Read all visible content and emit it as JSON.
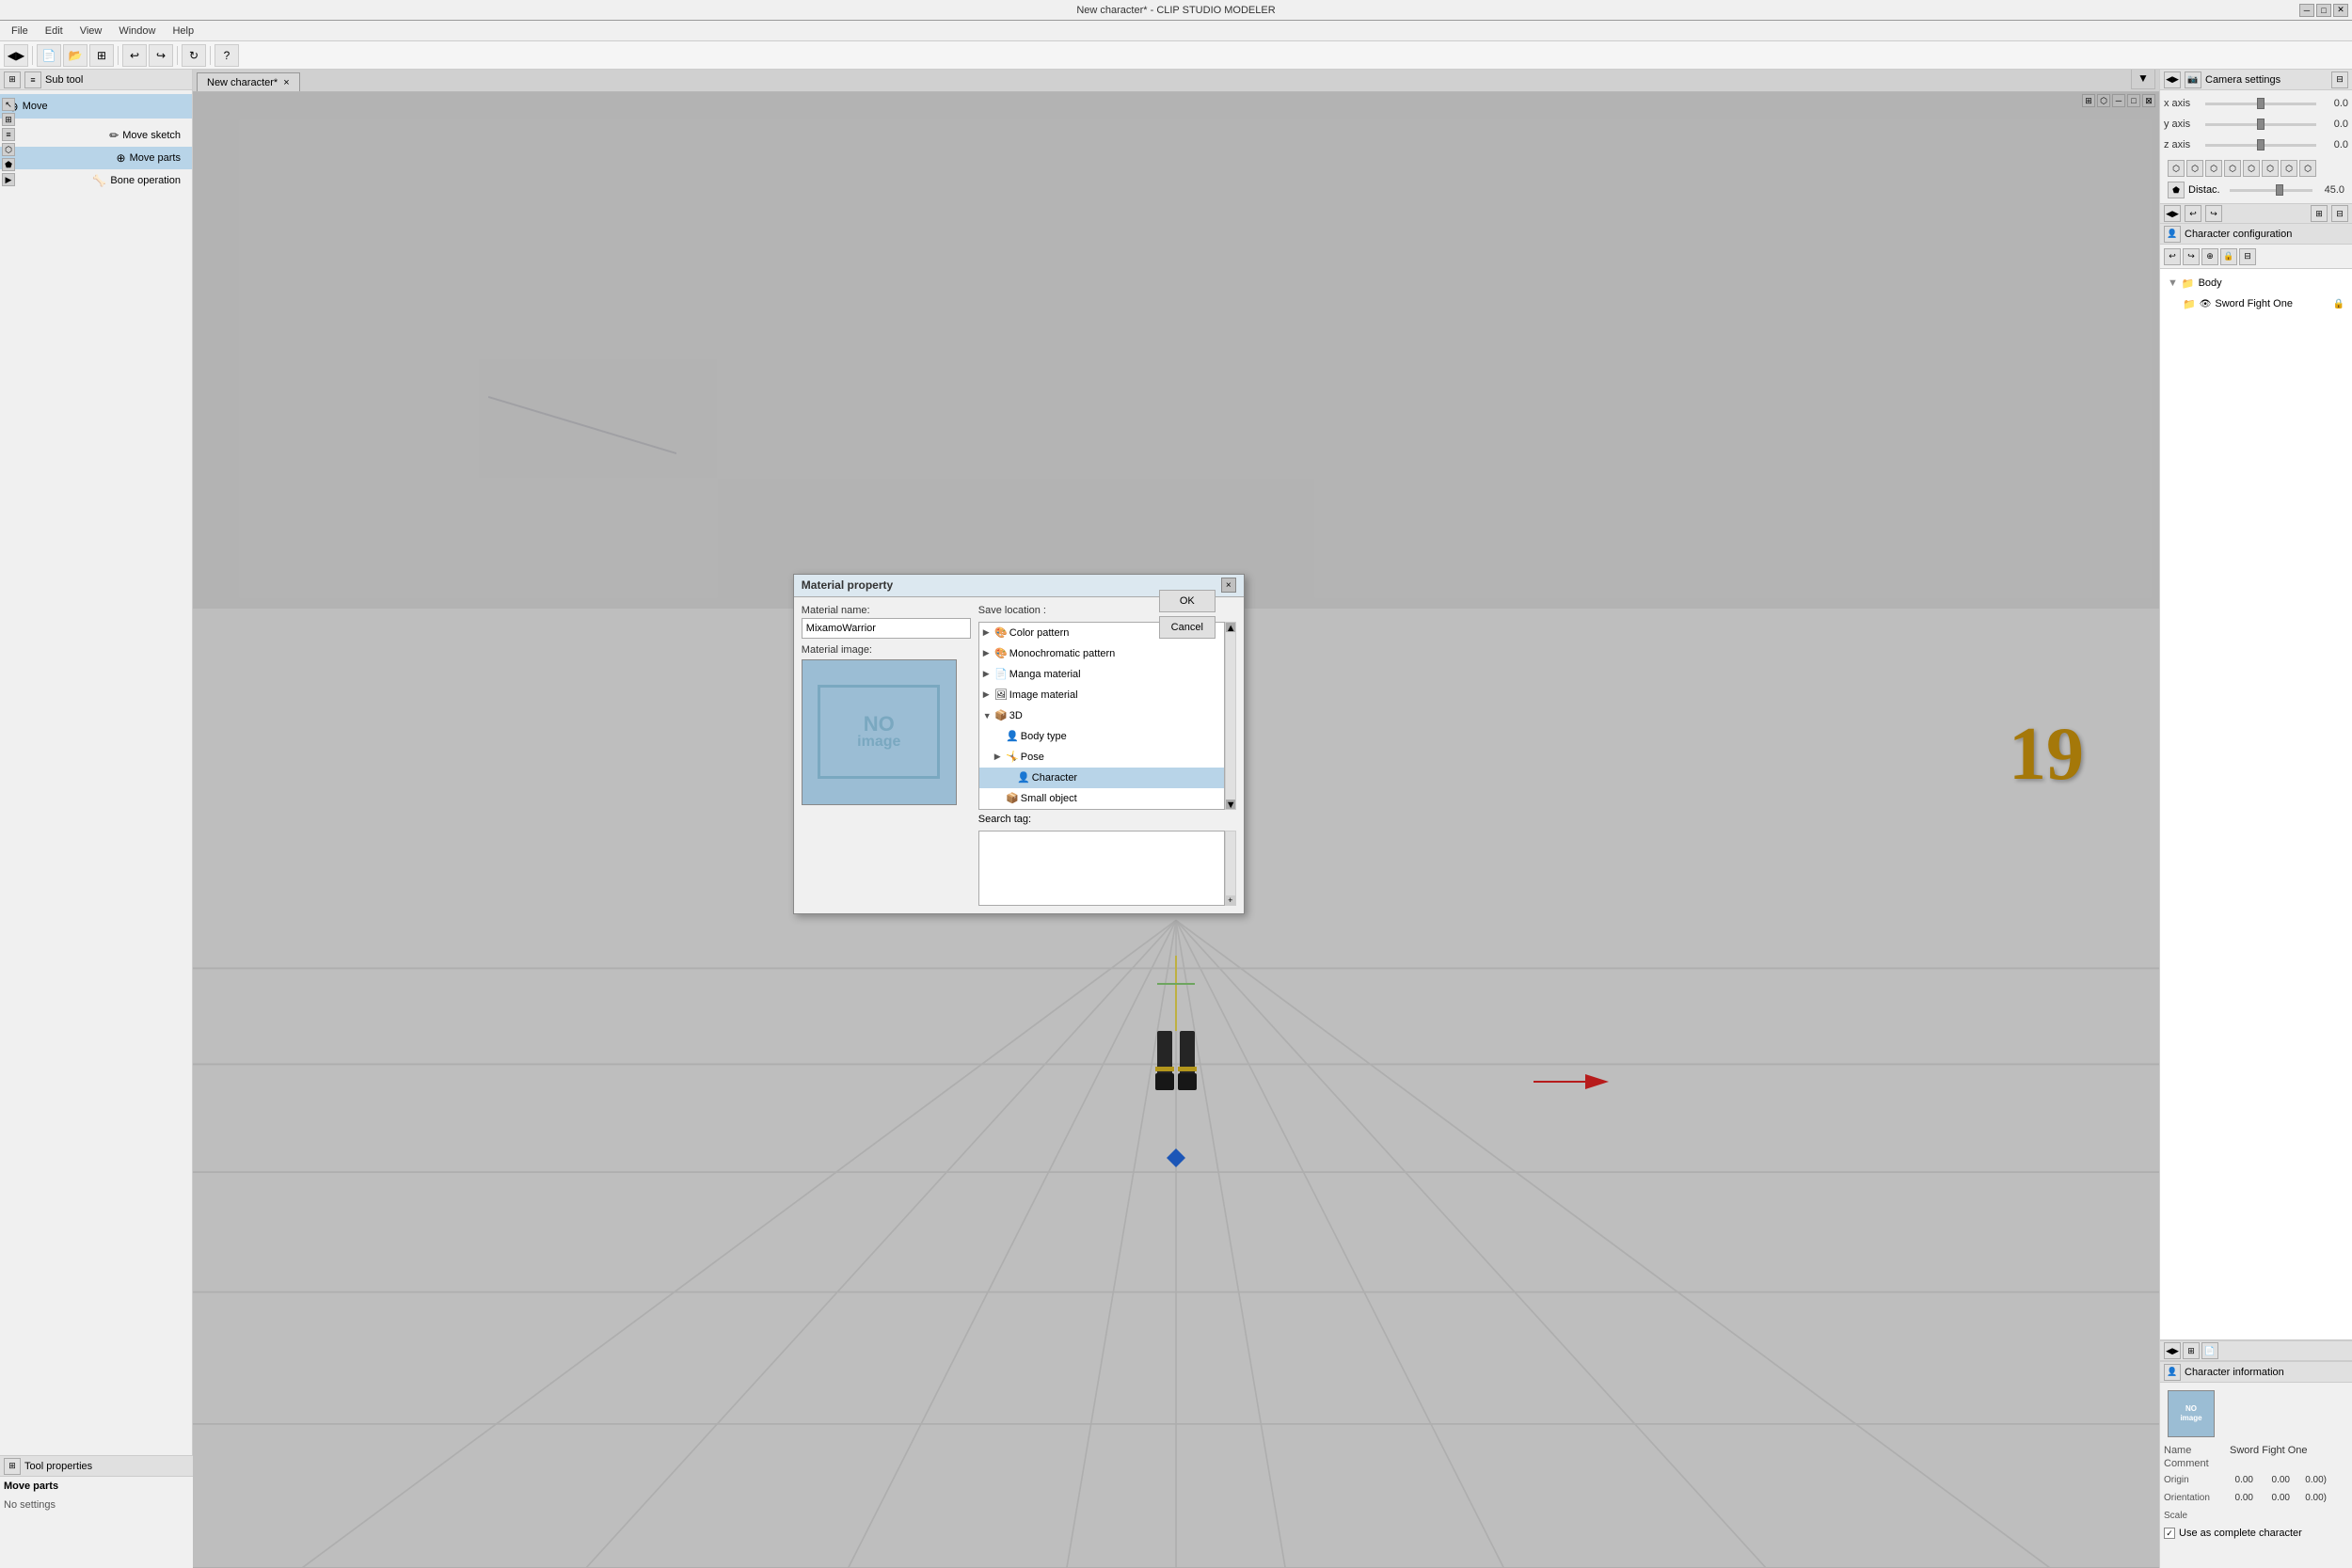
{
  "app": {
    "title": "New character* - CLIP STUDIO MODELER",
    "title_controls": [
      "minimize",
      "maximize",
      "close"
    ]
  },
  "menu": {
    "items": [
      "File",
      "Edit",
      "View",
      "Window",
      "Help"
    ]
  },
  "toolbar": {
    "buttons": [
      "save",
      "new",
      "open",
      "duplicate",
      "board",
      "undo",
      "redo",
      "refresh",
      "help"
    ]
  },
  "tab": {
    "label": "New character*",
    "close": "×"
  },
  "left_panel": {
    "header": "Sub tool",
    "tools": [
      {
        "id": "move",
        "label": "Move",
        "active": true,
        "icon": "⊕"
      },
      {
        "id": "move-sketch",
        "label": "Move sketch",
        "indent": true
      },
      {
        "id": "move-parts",
        "label": "Move parts",
        "indent": true,
        "active": true
      },
      {
        "id": "bone-op",
        "label": "Bone operation",
        "indent": true
      }
    ]
  },
  "tool_properties": {
    "header": "Tool properties",
    "sub_label": "Move parts",
    "content": "No settings"
  },
  "canvas": {
    "badge_number": "19"
  },
  "modal": {
    "title": "Material property",
    "close_btn": "×",
    "material_name_label": "Material name:",
    "material_name_value": "MixamoWarrior",
    "material_image_label": "Material image:",
    "no_image_line1": "NO",
    "no_image_line2": "image",
    "save_location_label": "Save location :",
    "location_tree": [
      {
        "id": "color-pattern",
        "label": "Color pattern",
        "level": 0,
        "arrow": "▶",
        "icon": "🎨"
      },
      {
        "id": "monochromatic",
        "label": "Monochromatic pattern",
        "level": 0,
        "arrow": "▶",
        "icon": "🎨"
      },
      {
        "id": "manga",
        "label": "Manga material",
        "level": 0,
        "arrow": "▶",
        "icon": "📄"
      },
      {
        "id": "image-material",
        "label": "Image material",
        "level": 0,
        "arrow": "▶",
        "icon": "🖼"
      },
      {
        "id": "3d",
        "label": "3D",
        "level": 0,
        "arrow": "▼",
        "icon": "📦"
      },
      {
        "id": "body-type",
        "label": "Body type",
        "level": 1,
        "arrow": "",
        "icon": "👤"
      },
      {
        "id": "pose",
        "label": "Pose",
        "level": 1,
        "arrow": "▶",
        "icon": "🤸"
      },
      {
        "id": "character",
        "label": "Character",
        "level": 2,
        "arrow": "",
        "icon": "👤",
        "selected": true
      },
      {
        "id": "small-object",
        "label": "Small object",
        "level": 1,
        "arrow": "",
        "icon": "📦"
      }
    ],
    "search_tag_label": "Search tag:",
    "ok_btn": "OK",
    "cancel_btn": "Cancel",
    "scrollbar_btn": "+"
  },
  "right_panel": {
    "camera_settings": {
      "header": "Camera settings",
      "axes": [
        {
          "label": "x axis",
          "value": "0.0"
        },
        {
          "label": "y axis",
          "value": "0.0"
        },
        {
          "label": "z axis",
          "value": "0.0"
        }
      ],
      "distac_label": "Distac.",
      "distac_value": "45.0"
    },
    "char_config": {
      "header": "Character configuration",
      "body_label": "Body",
      "item_label": "Sword Fight One"
    },
    "char_info": {
      "header": "Character information",
      "no_image_line1": "NO",
      "no_image_line2": "image",
      "name_label": "Name",
      "name_value": "Sword Fight One",
      "comment_label": "Comment",
      "comment_value": "",
      "origin_label": "Origin",
      "origin_values": [
        "0.00",
        "0.00",
        "0.00)"
      ],
      "orientation_label": "Orientation",
      "orientation_values": [
        "0.00",
        "0.00",
        "0.00)"
      ],
      "scale_label": "Scale",
      "use_complete_label": "Use as complete character"
    }
  }
}
